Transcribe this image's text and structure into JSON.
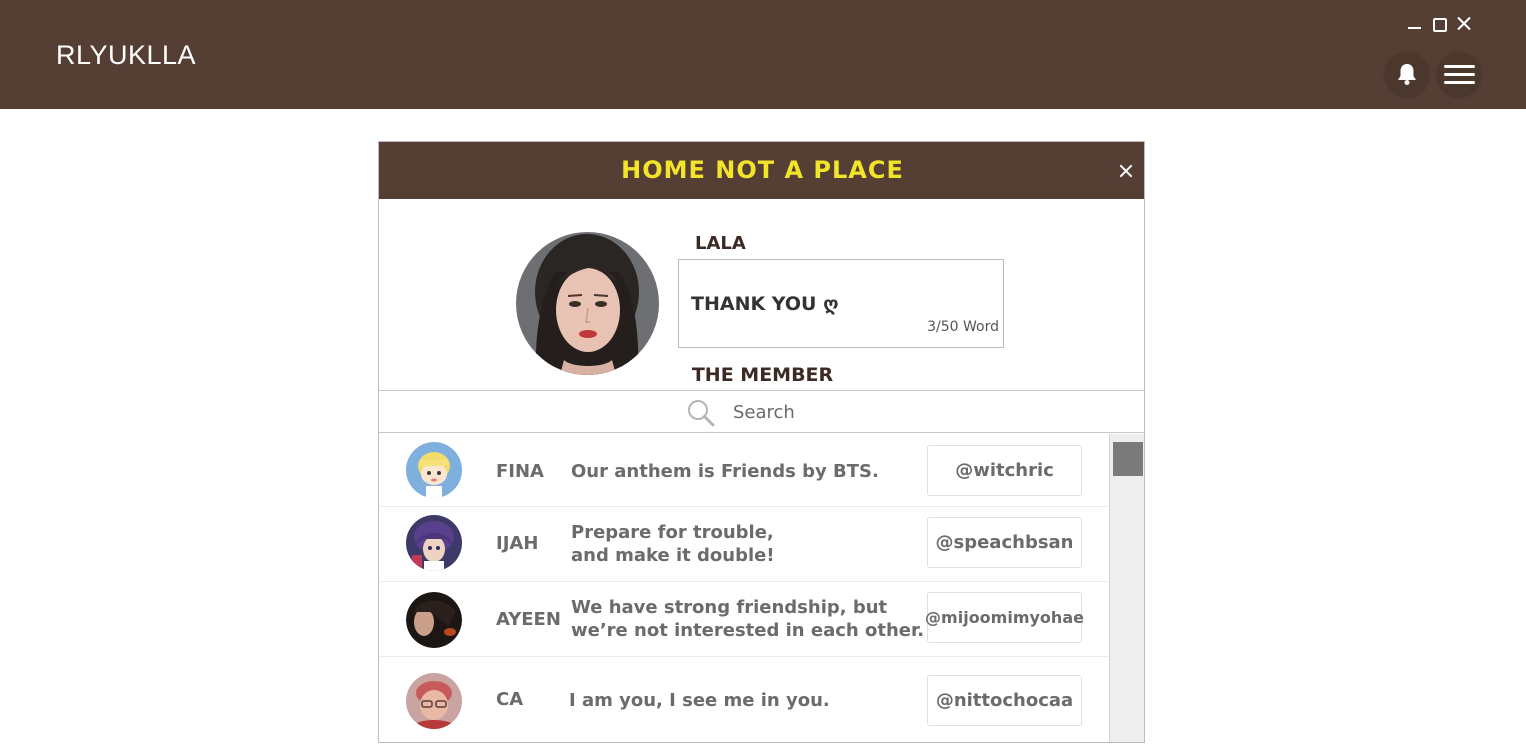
{
  "app": {
    "title": "RLYUKLLA"
  },
  "dialog": {
    "title": "HOME NOT A PLACE",
    "profile": {
      "name": "LALA",
      "status": "THANK YOU ღ",
      "count": "3/50 Word"
    },
    "members_title": "THE MEMBER",
    "search": {
      "placeholder": "Search"
    },
    "members": [
      {
        "name": "FINA",
        "message": [
          "Our anthem is Friends by BTS."
        ],
        "handle": "@witchric"
      },
      {
        "name": "IJAH",
        "message": [
          "Prepare for trouble,",
          "and make it double!"
        ],
        "handle": "@speachbsan"
      },
      {
        "name": "AYEEN",
        "message": [
          "We have strong friendship, but",
          "we’re not interested in each other."
        ],
        "handle": "@mijoomimyohae"
      },
      {
        "name": "CA",
        "message": [
          "I am you, I see me in you."
        ],
        "handle": "@nittochocaa"
      }
    ]
  },
  "colors": {
    "brand_brown": "#553f34",
    "title_yellow": "#f2e42a"
  },
  "icons": [
    "minimize-icon",
    "maximize-icon",
    "close-icon",
    "bell-icon",
    "hamburger-menu-icon",
    "search-icon",
    "scroll-thumb"
  ]
}
